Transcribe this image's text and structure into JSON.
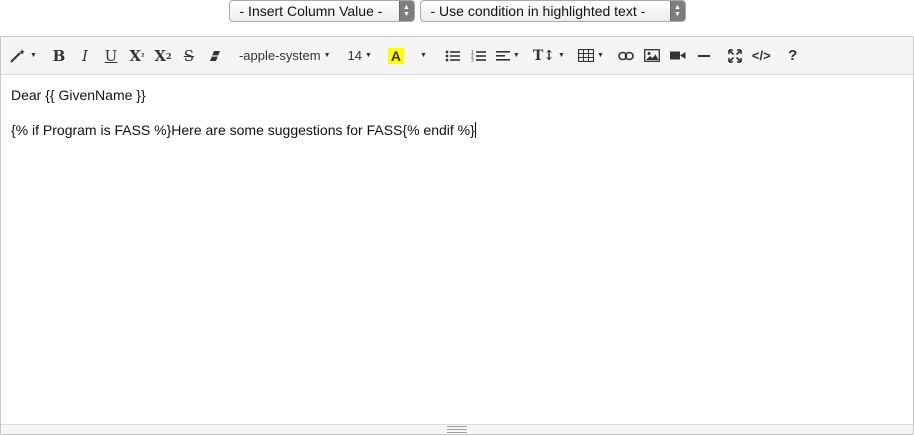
{
  "selects": {
    "column": {
      "value": "- Insert Column Value -"
    },
    "condition": {
      "value": "- Use condition in highlighted text -"
    }
  },
  "toolbar": {
    "style_icon": "magic-wand-icon",
    "bold_label": "B",
    "italic_label": "I",
    "underline_label": "U",
    "superscript_label": "X",
    "subscript_label": "X",
    "strikethrough_label": "S",
    "eraser_icon": "eraser-icon",
    "font_name": "-apple-system",
    "font_size": "14",
    "color_label": "A",
    "color_highlight": "#ffff00",
    "unordered_list_icon": "unordered-list-icon",
    "ordered_list_icon": "ordered-list-icon",
    "align_icon": "align-left-icon",
    "line_height_label": "T↕",
    "table_icon": "table-icon",
    "link_icon": "link-icon",
    "image_icon": "image-icon",
    "video_icon": "video-icon",
    "hr_icon": "horizontal-rule-icon",
    "fullscreen_icon": "fullscreen-icon",
    "codeview_label": "</>",
    "help_label": "?"
  },
  "editor": {
    "line1": "Dear {{ GivenName }}",
    "line2": "{% if Program is FASS %}Here are some suggestions for FASS{% endif %}"
  }
}
